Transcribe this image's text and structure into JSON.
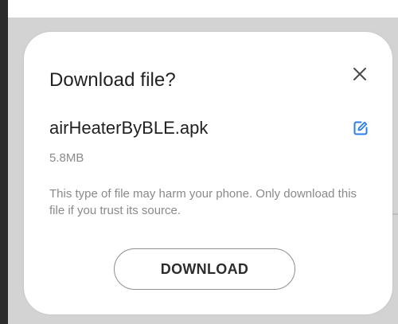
{
  "dialog": {
    "title": "Download file?",
    "close_icon": "close-icon",
    "file_name": "airHeaterByBLE.apk",
    "edit_icon": "edit-icon",
    "file_size": "5.8MB",
    "warning": "This type of file may harm your phone. Only download this file if you trust its source.",
    "download_label": "DOWNLOAD"
  },
  "colors": {
    "accent": "#2b7de9",
    "title_text": "#222222",
    "secondary_text": "#8a8a8a"
  }
}
